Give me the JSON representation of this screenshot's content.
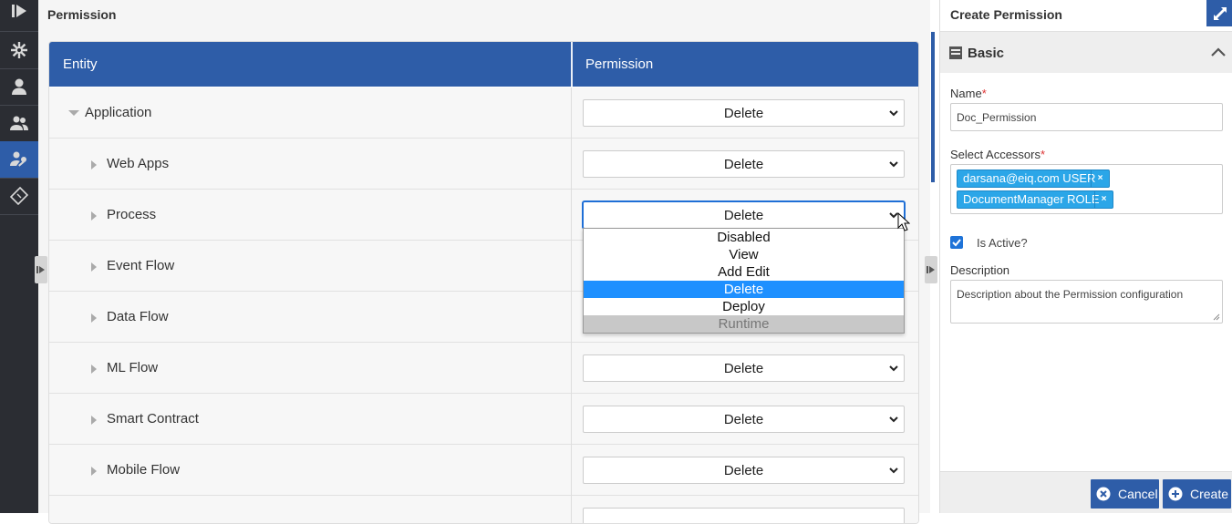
{
  "sidebar": {
    "items": [
      {
        "name": "logo-play-icon"
      },
      {
        "name": "settings-gear-icon"
      },
      {
        "name": "user-icon"
      },
      {
        "name": "users-group-icon"
      },
      {
        "name": "user-key-icon",
        "active": true
      },
      {
        "name": "ticket-icon"
      }
    ]
  },
  "main": {
    "title": "Permission",
    "table": {
      "headers": [
        "Entity",
        "Permission"
      ],
      "rows": [
        {
          "label": "Application",
          "value": "Delete",
          "expanded": true,
          "level": 0
        },
        {
          "label": "Web Apps",
          "value": "Delete",
          "level": 1
        },
        {
          "label": "Process",
          "value": "Delete",
          "level": 1,
          "focused": true
        },
        {
          "label": "Event Flow",
          "value": "",
          "level": 1
        },
        {
          "label": "Data Flow",
          "value": "",
          "level": 1
        },
        {
          "label": "ML Flow",
          "value": "Delete",
          "level": 1
        },
        {
          "label": "Smart Contract",
          "value": "Delete",
          "level": 1
        },
        {
          "label": "Mobile Flow",
          "value": "Delete",
          "level": 1
        }
      ]
    },
    "dropdown": {
      "options": [
        "Disabled",
        "View",
        "Add Edit",
        "Delete",
        "Deploy",
        "Runtime"
      ],
      "selected": "Delete",
      "disabled": [
        "Runtime"
      ]
    }
  },
  "panel": {
    "title": "Create Permission",
    "section": "Basic",
    "name_label": "Name",
    "name_value": "Doc_Permission",
    "accessors_label": "Select Accessors",
    "accessors": [
      "darsana@eiq.com USER",
      "DocumentManager ROLE"
    ],
    "tag_remove": "×",
    "is_active_label": "Is Active?",
    "is_active": true,
    "description_label": "Description",
    "description_placeholder": "Description about the Permission configuration",
    "cancel_label": "Cancel",
    "create_label": "Create",
    "required_mark": "*"
  },
  "colors": {
    "accent": "#2e5da8",
    "tag": "#2ba6e8",
    "sidebar": "#2b2d33",
    "selected": "#1e90ff"
  }
}
